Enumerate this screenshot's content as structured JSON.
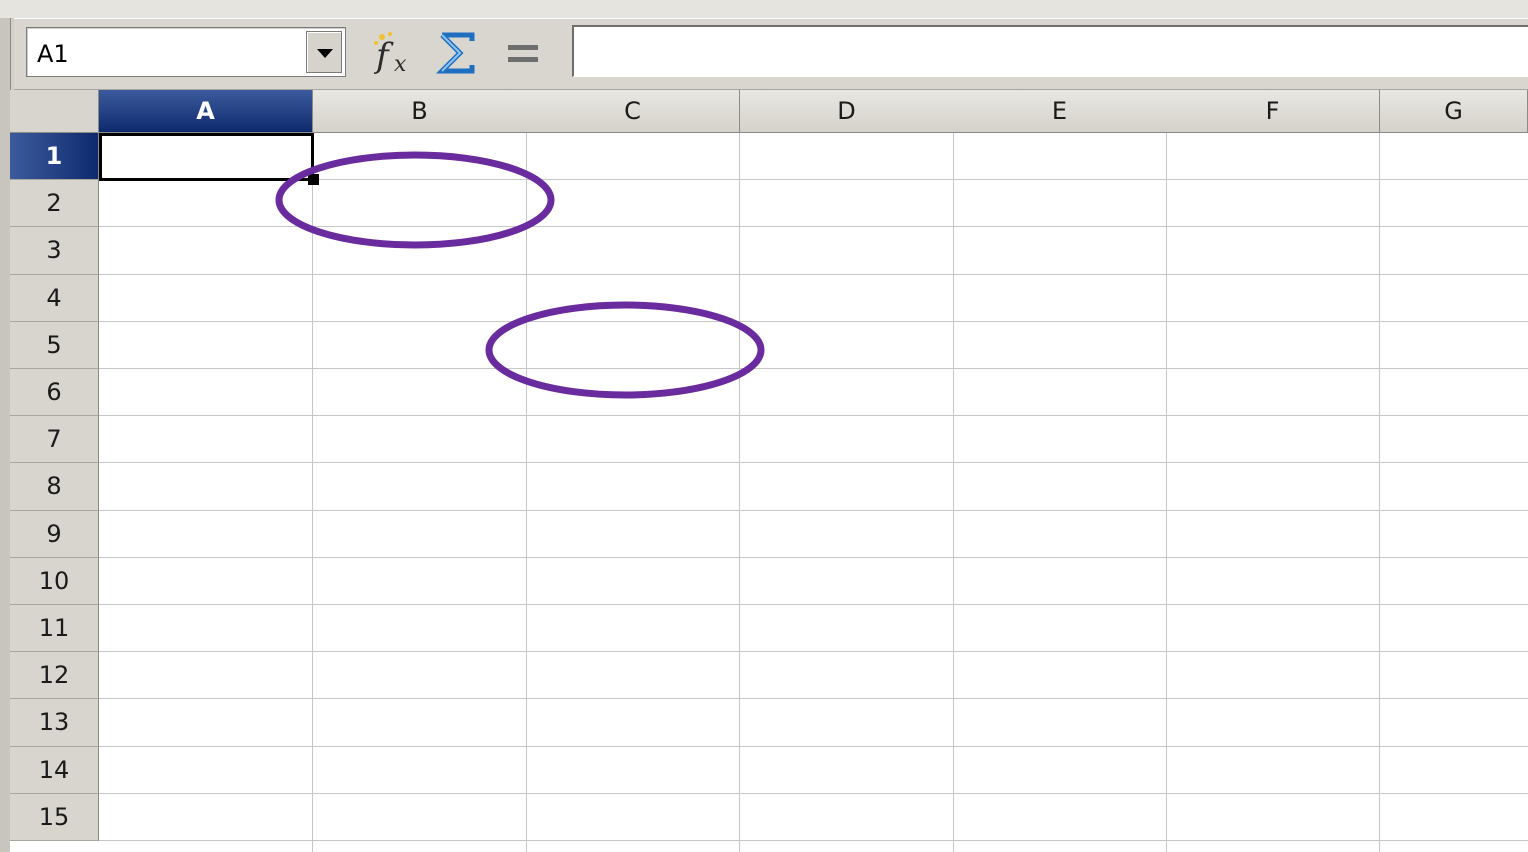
{
  "name_box": {
    "value": "A1"
  },
  "formula_bar": {
    "value": "",
    "equals_label": "="
  },
  "icons": {
    "name_box_dropdown": "chevron-down-icon",
    "function_wizard": "function-wizard-icon",
    "sum": "sum-icon",
    "equals": "equals-icon"
  },
  "columns": [
    "A",
    "B",
    "C",
    "D",
    "E",
    "F",
    "G"
  ],
  "rows": [
    "1",
    "2",
    "3",
    "4",
    "5",
    "6",
    "7",
    "8",
    "9",
    "10",
    "11",
    "12",
    "13",
    "14",
    "15"
  ],
  "selection": {
    "cell": "A1",
    "column": "A",
    "row": "1"
  },
  "colors": {
    "selected_header": "#0d2a6e",
    "annotation_ellipse": "#6a2b9e",
    "gridline": "#c6c6c6"
  }
}
